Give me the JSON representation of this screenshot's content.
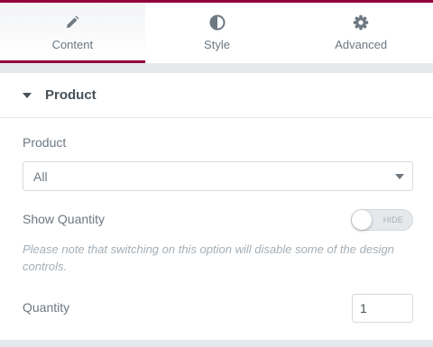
{
  "tabs": [
    {
      "label": "Content",
      "icon": "pencil-icon",
      "active": true
    },
    {
      "label": "Style",
      "icon": "half-circle-icon",
      "active": false
    },
    {
      "label": "Advanced",
      "icon": "gear-icon",
      "active": false
    }
  ],
  "section": {
    "title": "Product"
  },
  "product_control": {
    "label": "Product",
    "value": "All"
  },
  "show_quantity": {
    "label": "Show Quantity",
    "toggle_text": "HIDE",
    "enabled": false
  },
  "note": "Please note that switching on this option will disable some of the design controls.",
  "quantity": {
    "label": "Quantity",
    "value": "1"
  },
  "colors": {
    "accent": "#93003c",
    "text": "#6d7882",
    "heading": "#495157",
    "muted": "#a4afb7",
    "border": "#d5dadf",
    "bg": "#e6e9ec"
  }
}
